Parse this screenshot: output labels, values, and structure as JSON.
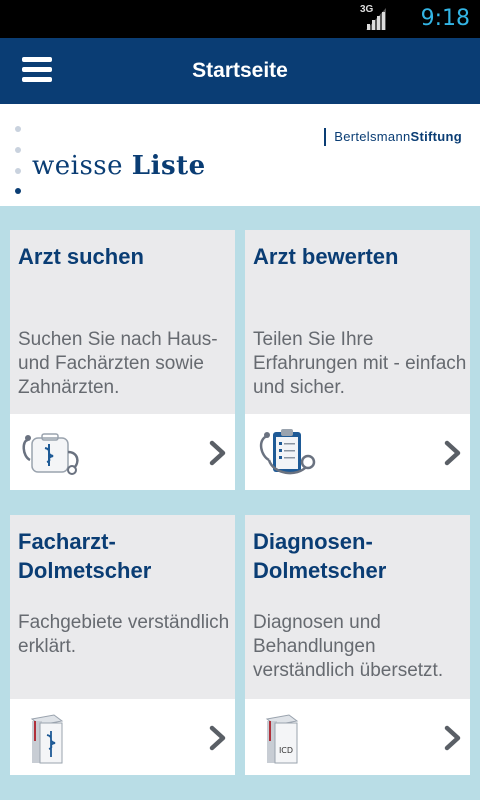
{
  "status_bar": {
    "network": "3G",
    "time": "9:18"
  },
  "header": {
    "title": "Startseite"
  },
  "logo": {
    "brand_light": "weisse ",
    "brand_bold": "Liste",
    "sponsor_light": "Bertelsmann",
    "sponsor_bold": "Stiftung"
  },
  "cards": [
    {
      "title": "Arzt suchen",
      "description": "Suchen Sie nach Haus- und Fachärzten sowie Zahnärzten.",
      "icon": "stethoscope-bag-icon"
    },
    {
      "title": "Arzt bewerten",
      "description": "Teilen Sie Ihre Erfahrungen mit - einfach und sicher.",
      "icon": "clipboard-stethoscope-icon"
    },
    {
      "title": "Facharzt-Dolmetscher",
      "description": "Fachgebiete verständlich erklärt.",
      "icon": "medical-book-icon"
    },
    {
      "title": "Diagnosen-Dolmetscher",
      "description": "Diagnosen und Behandlungen verständlich übersetzt.",
      "icon": "icd-book-icon",
      "icon_label": "ICD"
    }
  ],
  "colors": {
    "primary": "#0a3d74",
    "background": "#b9dde6",
    "card": "#eaeaec",
    "status_accent": "#33b5e5"
  }
}
